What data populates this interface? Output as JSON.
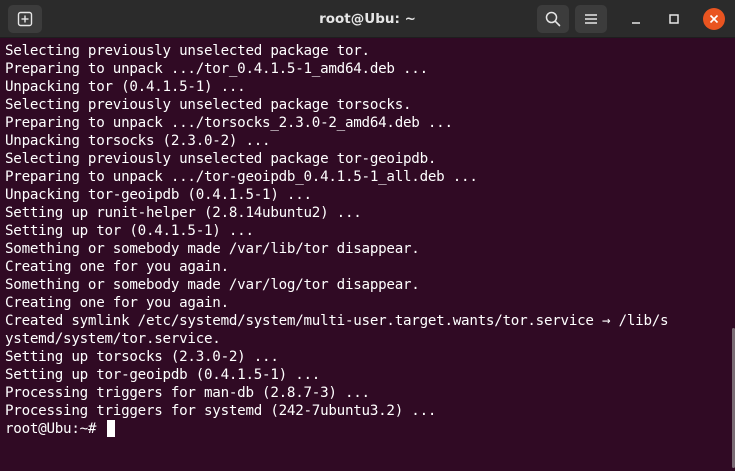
{
  "window": {
    "title": "root@Ubu: ~"
  },
  "icons": {
    "new_tab": "new-tab-icon",
    "search": "search-icon",
    "menu": "hamburger-menu-icon",
    "minimize": "minimize-icon",
    "maximize": "maximize-icon",
    "close": "close-icon"
  },
  "colors": {
    "terminal_background": "#300a24",
    "text": "#ffffff",
    "close_button": "#e95420",
    "titlebar": "#2b2b2b"
  },
  "terminal": {
    "lines": [
      "Selecting previously unselected package tor.",
      "Preparing to unpack .../tor_0.4.1.5-1_amd64.deb ...",
      "Unpacking tor (0.4.1.5-1) ...",
      "Selecting previously unselected package torsocks.",
      "Preparing to unpack .../torsocks_2.3.0-2_amd64.deb ...",
      "Unpacking torsocks (2.3.0-2) ...",
      "Selecting previously unselected package tor-geoipdb.",
      "Preparing to unpack .../tor-geoipdb_0.4.1.5-1_all.deb ...",
      "Unpacking tor-geoipdb (0.4.1.5-1) ...",
      "Setting up runit-helper (2.8.14ubuntu2) ...",
      "Setting up tor (0.4.1.5-1) ...",
      "Something or somebody made /var/lib/tor disappear.",
      "Creating one for you again.",
      "Something or somebody made /var/log/tor disappear.",
      "Creating one for you again.",
      "Created symlink /etc/systemd/system/multi-user.target.wants/tor.service → /lib/s",
      "ystemd/system/tor.service.",
      "Setting up torsocks (2.3.0-2) ...",
      "Setting up tor-geoipdb (0.4.1.5-1) ...",
      "Processing triggers for man-db (2.8.7-3) ...",
      "Processing triggers for systemd (242-7ubuntu3.2) ..."
    ],
    "prompt": "root@Ubu:~# "
  }
}
